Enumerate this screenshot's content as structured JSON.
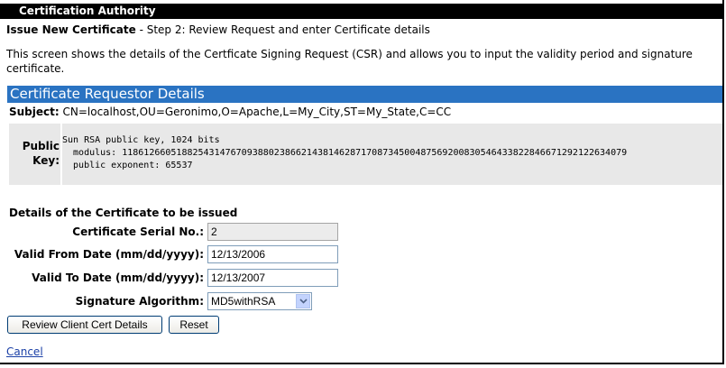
{
  "window": {
    "title": "Certification Authority"
  },
  "header": {
    "title_bold": "Issue New Certificate",
    "title_rest": " - Step 2: Review Request and enter Certificate details"
  },
  "intro": {
    "line1": "This screen shows the details of the Certficate Signing Request (CSR) and allows you to input the validity period and signature",
    "line2": "certificate."
  },
  "requestor": {
    "section_title": "Certificate Requestor Details",
    "subject_label": "Subject:",
    "subject_value": " CN=localhost,OU=Geronimo,O=Apache,L=My_City,ST=My_State,C=CC",
    "public_key_label_1": "Public",
    "public_key_label_2": "Key:",
    "public_key_line1": "Sun RSA public key, 1024 bits",
    "public_key_line2": "  modulus: 118612660518825431476709388023866214381462871708734500487569200830546433822846671292122634079",
    "public_key_line3": "  public exponent: 65537"
  },
  "details": {
    "section_title": "Details of the Certificate to be issued",
    "serial_label": "Certificate Serial No.:",
    "serial_value": "2",
    "valid_from_label": "Valid From Date (mm/dd/yyyy):",
    "valid_from_value": "12/13/2006",
    "valid_to_label": "Valid To Date (mm/dd/yyyy):",
    "valid_to_value": "12/13/2007",
    "algorithm_label": "Signature Algorithm:",
    "algorithm_value": "MD5withRSA"
  },
  "actions": {
    "review_label": "Review Client Cert Details",
    "reset_label": "Reset",
    "cancel_label": "Cancel"
  },
  "icons": {
    "select_arrow": "chevron-down-icon"
  }
}
